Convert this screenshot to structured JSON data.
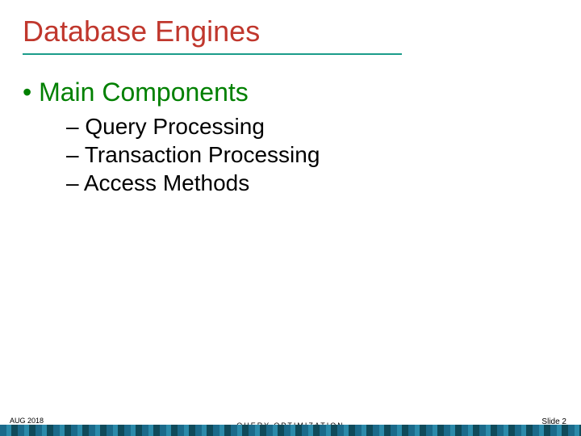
{
  "title": "Database Engines",
  "main_bullet": "Main Components",
  "sub_bullets": {
    "0": "Query Processing",
    "1": "Transaction Processing",
    "2": "Access Methods"
  },
  "footer": {
    "date": "AUG 2018",
    "center": "QUERY  OPTIMIZATION",
    "slide": "Slide 2"
  }
}
